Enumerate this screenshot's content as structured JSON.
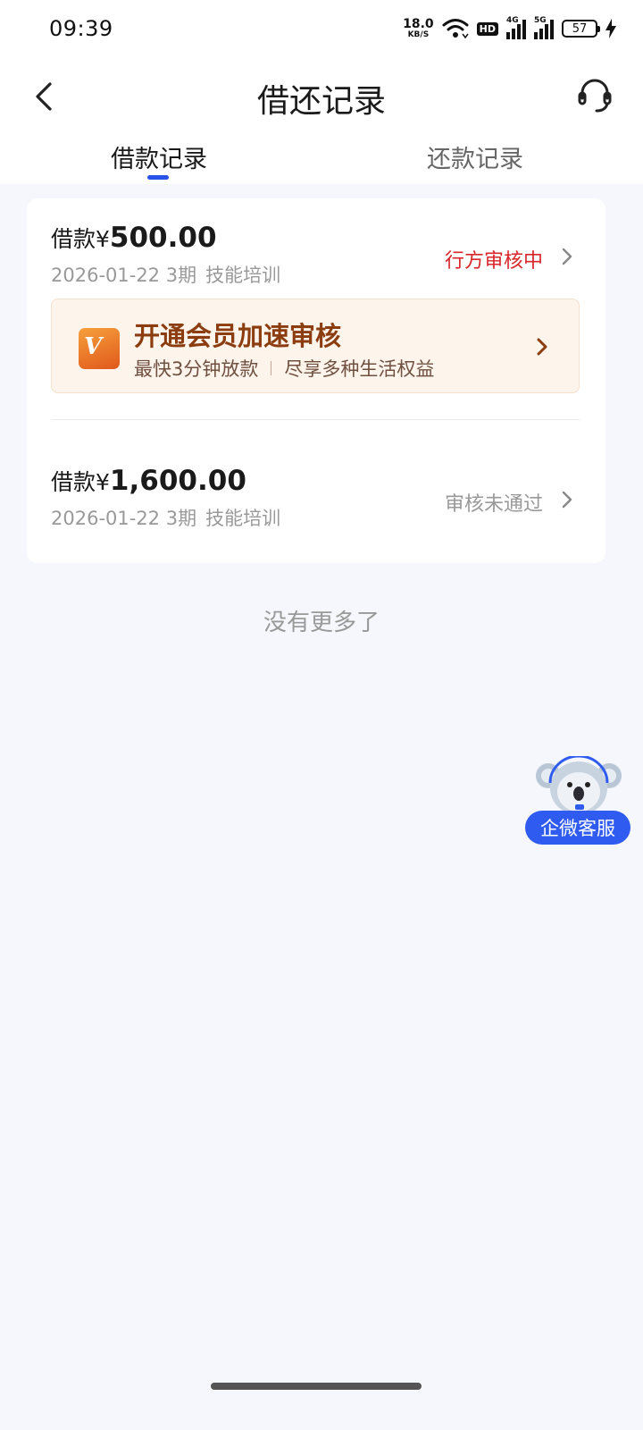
{
  "status_bar": {
    "time": "09:39",
    "net_speed_value": "18.0",
    "net_speed_unit": "KB/S",
    "hd_label": "HD",
    "signal_1_label": "4G",
    "signal_2_label": "5G",
    "battery_level": "57",
    "icons": [
      "wifi-icon",
      "hd-icon",
      "signal-4g-icon",
      "signal-5g-icon",
      "battery-icon",
      "charging-icon"
    ]
  },
  "header": {
    "title": "借还记录",
    "back_icon": "chevron-left-icon",
    "support_icon": "headset-icon"
  },
  "tabs": [
    {
      "label": "借款记录",
      "active": true
    },
    {
      "label": "还款记录",
      "active": false
    }
  ],
  "loans": [
    {
      "amount_prefix": "借款",
      "currency": "¥",
      "amount": "500.00",
      "date": "2026-01-22",
      "term": "3期",
      "purpose": "技能培训",
      "status": "行方审核中",
      "status_color": "#d8262b"
    },
    {
      "amount_prefix": "借款",
      "currency": "¥",
      "amount": "1,600.00",
      "date": "2026-01-22",
      "term": "3期",
      "purpose": "技能培训",
      "status": "审核未通过",
      "status_color": "#999999"
    }
  ],
  "vip_banner": {
    "logo_text": "VIP",
    "title": "开通会员加速审核",
    "subtitle_left": "最快3分钟放款",
    "subtitle_right": "尽享多种生活权益"
  },
  "footer_text": "没有更多了",
  "floating_support": {
    "label": "企微客服",
    "mascot_icon": "koala-mascot-icon",
    "color": "#2f5bf0"
  },
  "colors": {
    "accent": "#2952e8",
    "background": "#f6f7fc",
    "vip_bg": "#fdf4ec",
    "vip_title": "#8b3d10"
  }
}
